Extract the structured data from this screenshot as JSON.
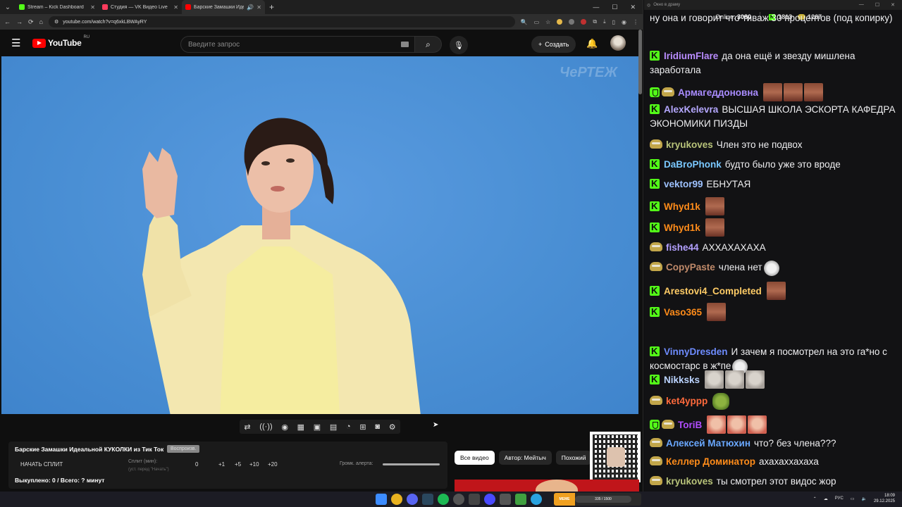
{
  "browser": {
    "tabs": [
      {
        "label": "Stream – Kick Dashboard",
        "color": "#53fc18",
        "active": false
      },
      {
        "label": "Студия — VK Видео Live",
        "color": "#ff3b5c",
        "active": false
      },
      {
        "label": "Барские Замашки Идеаль",
        "color": "#ff0000",
        "active": true
      }
    ],
    "url": "youtube.com/watch?v=q6xkLBWAyRY"
  },
  "youtube": {
    "logo_text": "YouTube",
    "region": "RU",
    "search_placeholder": "Введите запрос",
    "create_label": "Создать"
  },
  "video": {
    "watermark": "ЧеРТЕЖ"
  },
  "panel": {
    "title": "Барские Замашки Идеальной КУКОЛКИ из Тик Ток",
    "title_button": "Воспроизв.",
    "start_split": "НАЧАТЬ СПЛИТ",
    "split_label": "Сплит (мин):",
    "split_hint": "(уст. перед \"Начать\")",
    "split_values": [
      "0",
      "+1",
      "+5",
      "+10",
      "+20"
    ],
    "alert_volume_label": "Громк. алерта:",
    "bought": "Выкуплено: 0 / Всего: ? минут"
  },
  "chips": [
    "Все видео",
    "Автор: Мейтыч",
    "Похожий"
  ],
  "chat": {
    "title": "Окно в драму",
    "online_label": "Online:",
    "online_count": "3080",
    "kick_count": "1813",
    "other_count": "1267",
    "top_text": "ну она и говорит что тиваж 30 процентов (под копирку)",
    "messages": [
      {
        "user": "IridiumFlare",
        "color": "#b98cff",
        "badge": "kick",
        "text": "да она ещё и звезду мишлена заработала",
        "emotes": []
      },
      {
        "user": "Армагеддоновна",
        "color": "#a98cff",
        "badge": "shield-pepe",
        "text": "",
        "emotes": [
          "face",
          "face",
          "face"
        ]
      },
      {
        "user": "AlexKelevra",
        "color": "#b5a8ff",
        "badge": "kick",
        "text": "ВЫСШАЯ ШКОЛА ЭСКОРТА КАФЕДРА ЭКОНОМИКИ ПИЗДЫ",
        "emotes": []
      },
      {
        "user": "kryukoves",
        "color": "#b9c47a",
        "badge": "pepe",
        "text": "Член это не подвох",
        "emotes": []
      },
      {
        "user": "DaBroPhonk",
        "color": "#7ac8ff",
        "badge": "kick",
        "text": "будто было уже это вроде",
        "emotes": []
      },
      {
        "user": "vektor99",
        "color": "#9ec2ff",
        "badge": "kick",
        "text": "ЕБНУТАЯ",
        "emotes": []
      },
      {
        "user": "Whyd1k",
        "color": "#ff8c1a",
        "badge": "kick",
        "text": "",
        "emotes": [
          "face"
        ]
      },
      {
        "user": "Whyd1k",
        "color": "#ff8c1a",
        "badge": "kick",
        "text": "",
        "emotes": [
          "face"
        ]
      },
      {
        "user": "fishe44",
        "color": "#b3a0ff",
        "badge": "pepe",
        "text": "АХХАХАХАХА",
        "emotes": []
      },
      {
        "user": "CopyPaste",
        "color": "#c08a6a",
        "badge": "pepe",
        "text": "члена нет",
        "emotes": [
          "cat"
        ]
      },
      {
        "user": "Arestovi4_Completed",
        "color": "#ffcc66",
        "badge": "kick",
        "text": "",
        "emotes": [
          "face"
        ]
      },
      {
        "user": "Vaso365",
        "color": "#ff8c1a",
        "badge": "kick",
        "text": "",
        "emotes": [
          "face"
        ]
      },
      {
        "user": "VinnyDresden",
        "color": "#6e8cff",
        "badge": "kick",
        "text": "И зачем я посмотрел на это га*но с космостарс в ж*пе",
        "emotes": [
          "cat"
        ]
      },
      {
        "user": "Nikksks",
        "color": "#bcd4ff",
        "badge": "kick",
        "text": "",
        "emotes": [
          "gray",
          "gray",
          "gray"
        ]
      },
      {
        "user": "ket4yppp",
        "color": "#ff6a3c",
        "badge": "pepe",
        "text": "",
        "emotes": [
          "frog"
        ]
      },
      {
        "user": "ToriB",
        "color": "#b04cff",
        "badge": "shield-pepe",
        "text": "",
        "emotes": [
          "red",
          "red",
          "red"
        ]
      },
      {
        "user": "Алексей Матюхин",
        "color": "#6aa8ff",
        "badge": "pepe",
        "text": "что? без члена???",
        "emotes": []
      },
      {
        "user": "Келлер Доминатор",
        "color": "#ff8c1a",
        "badge": "pepe",
        "text": "ахахаххахаха",
        "emotes": []
      },
      {
        "user": "kryukoves",
        "color": "#b9c47a",
        "badge": "pepe",
        "text": "ты смотрел этот видос жор",
        "emotes": []
      }
    ]
  },
  "taskbar": {
    "party_label": "MEME PARTY",
    "party_progress": "335 / 1500",
    "lang": "РУС",
    "time": "18:09",
    "date": "29.12.2025"
  }
}
